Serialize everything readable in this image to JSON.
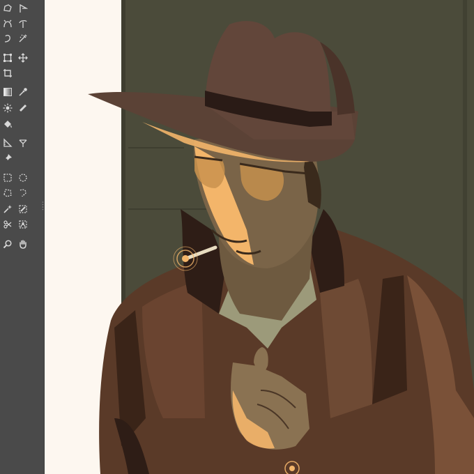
{
  "toolbox": {
    "tools": [
      {
        "name": "free-select-tool",
        "icon": "lasso-icon"
      },
      {
        "name": "path-tool",
        "icon": "path-icon"
      },
      {
        "name": "warp-transform-tool",
        "icon": "warp-icon"
      },
      {
        "name": "paths-tool",
        "icon": "bezier-icon"
      },
      {
        "name": "smudge-tool",
        "icon": "smudge-icon"
      },
      {
        "name": "airbrush-tool",
        "icon": "airbrush-icon"
      },
      {
        "name": "unified-transform-tool",
        "icon": "transform-icon"
      },
      {
        "name": "move-tool",
        "icon": "move-icon"
      },
      {
        "name": "crop-tool",
        "icon": "crop-icon"
      },
      {
        "name": "gradient-tool",
        "icon": "gradient-icon"
      },
      {
        "name": "color-picker-tool",
        "icon": "eyedropper-icon"
      },
      {
        "name": "dodge-burn-tool",
        "icon": "sun-icon"
      },
      {
        "name": "heal-tool",
        "icon": "heal-icon"
      },
      {
        "name": "bucket-fill-tool",
        "icon": "bucket-icon"
      },
      {
        "name": "measure-tool",
        "icon": "ruler-icon"
      },
      {
        "name": "text-tool",
        "icon": "text-icon"
      },
      {
        "name": "pin-tool",
        "icon": "pin-icon"
      },
      {
        "name": "rect-select-tool",
        "icon": "rect-select-icon"
      },
      {
        "name": "ellipse-select-tool",
        "icon": "ellipse-select-icon"
      },
      {
        "name": "polygon-select-tool",
        "icon": "polygon-select-icon"
      },
      {
        "name": "fuzzy-select-tool",
        "icon": "fuzzy-select-icon"
      },
      {
        "name": "magic-wand-tool",
        "icon": "magic-wand-icon"
      },
      {
        "name": "paint-select-tool",
        "icon": "paint-select-icon"
      },
      {
        "name": "scissors-select-tool",
        "icon": "scissors-icon"
      },
      {
        "name": "foreground-select-tool",
        "icon": "foreground-select-icon"
      },
      {
        "name": "zoom-tool",
        "icon": "zoom-icon"
      },
      {
        "name": "hand-tool",
        "icon": "hand-icon"
      }
    ]
  },
  "colors": {
    "toolbox_bg": "#4a4a4a",
    "icon": "#d8d8d8",
    "canvas_bg": "#fdf7f0",
    "wall": "#4b4b3a",
    "hat": "#5b4236",
    "jacket": "#5a3a28",
    "highlight": "#f3b56a"
  }
}
